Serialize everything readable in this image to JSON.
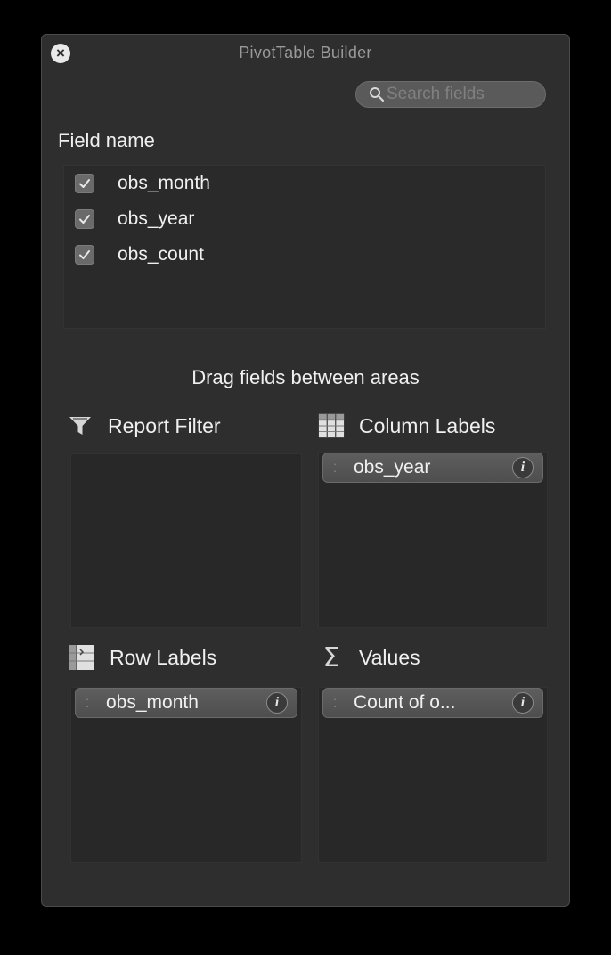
{
  "window": {
    "title": "PivotTable Builder",
    "close_glyph": "×"
  },
  "search": {
    "placeholder": "Search fields"
  },
  "fields": {
    "heading": "Field name",
    "items": [
      {
        "label": "obs_month",
        "checked": true
      },
      {
        "label": "obs_year",
        "checked": true
      },
      {
        "label": "obs_count",
        "checked": true
      }
    ]
  },
  "areas": {
    "heading": "Drag fields between areas",
    "report_filter": {
      "label": "Report Filter",
      "icon": "funnel-icon",
      "items": []
    },
    "column_labels": {
      "label": "Column Labels",
      "icon": "column-labels-icon",
      "items": [
        "obs_year"
      ]
    },
    "row_labels": {
      "label": "Row Labels",
      "icon": "row-labels-icon",
      "items": [
        "obs_month"
      ]
    },
    "values": {
      "label": "Values",
      "icon": "sigma-icon",
      "glyph": "Σ",
      "items": [
        "Count of o..."
      ]
    }
  },
  "pill_info_glyph": "i",
  "colors": {
    "panel_bg": "#2e2e2e",
    "area_bg": "#282828",
    "pill_bg": "#5a5a5a",
    "text": "#f0f0f0",
    "title_text": "#9a9a9a"
  }
}
